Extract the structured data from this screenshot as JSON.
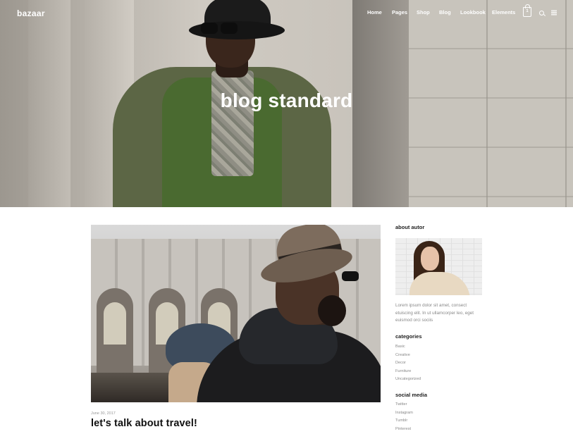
{
  "header": {
    "logo": "bazaar",
    "nav": [
      "Home",
      "Pages",
      "Shop",
      "Blog",
      "Lookbook",
      "Elements"
    ],
    "cart_count": "1"
  },
  "hero": {
    "title": "blog standard"
  },
  "post": {
    "date": "June 30, 2017",
    "title": "let's talk about travel!"
  },
  "sidebar": {
    "about_heading": "about autor",
    "about_text": "Lorem ipsum dolor sit amet, consect etuiscing elit. In ut ullamcorper leo, eget euismod orci sociis",
    "categories_heading": "categories",
    "categories": [
      "Basic",
      "Creative",
      "Decor",
      "Furniture",
      "Uncategorized"
    ],
    "social_heading": "social media",
    "social": [
      "Twitter",
      "Instagram",
      "Tumblr",
      "Pinterest"
    ]
  },
  "icons": [
    "cart-icon",
    "search-icon",
    "grid-menu-icon"
  ]
}
